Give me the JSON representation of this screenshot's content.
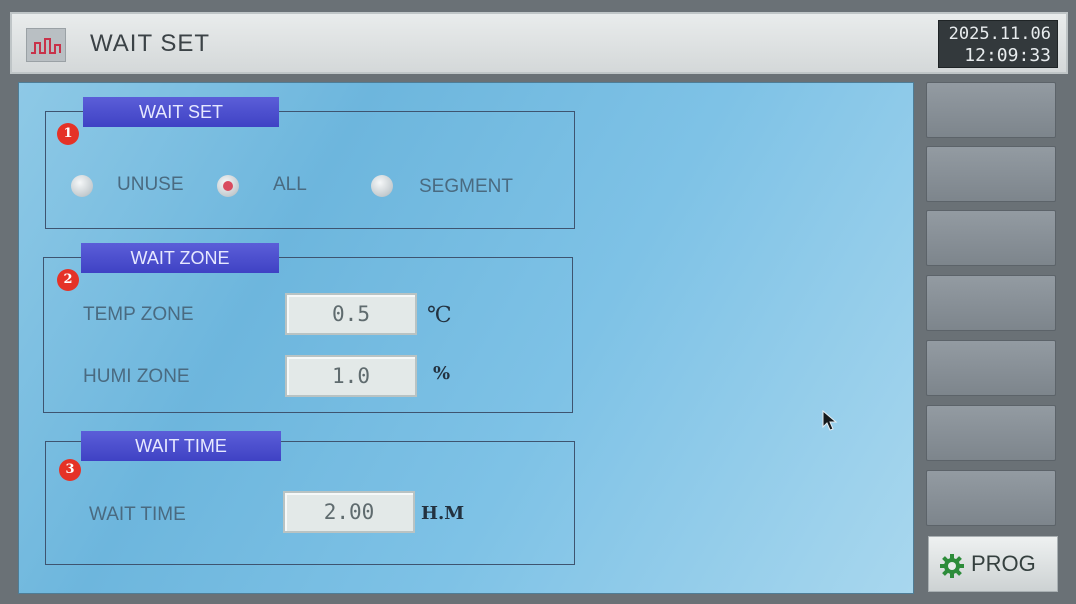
{
  "header": {
    "title": "WAIT SET",
    "date": "2025.11.06",
    "time": "12:09:33"
  },
  "wait_set": {
    "label": "WAIT SET",
    "badge": "1",
    "options": [
      "UNUSE",
      "ALL",
      "SEGMENT"
    ],
    "selected": "ALL"
  },
  "wait_zone": {
    "label": "WAIT ZONE",
    "badge": "2",
    "temp_label": "TEMP ZONE",
    "temp_value": "0.5",
    "temp_unit": "℃",
    "humi_label": "HUMI ZONE",
    "humi_value": "1.0",
    "humi_unit": "%"
  },
  "wait_time": {
    "label": "WAIT TIME",
    "badge": "3",
    "time_label": "WAIT TIME",
    "time_value": "2.00",
    "time_unit": "H.M"
  },
  "side": {
    "prog_label": "PROG",
    "colors": {
      "accent": "#3f42c4",
      "badge": "#e53227"
    }
  }
}
